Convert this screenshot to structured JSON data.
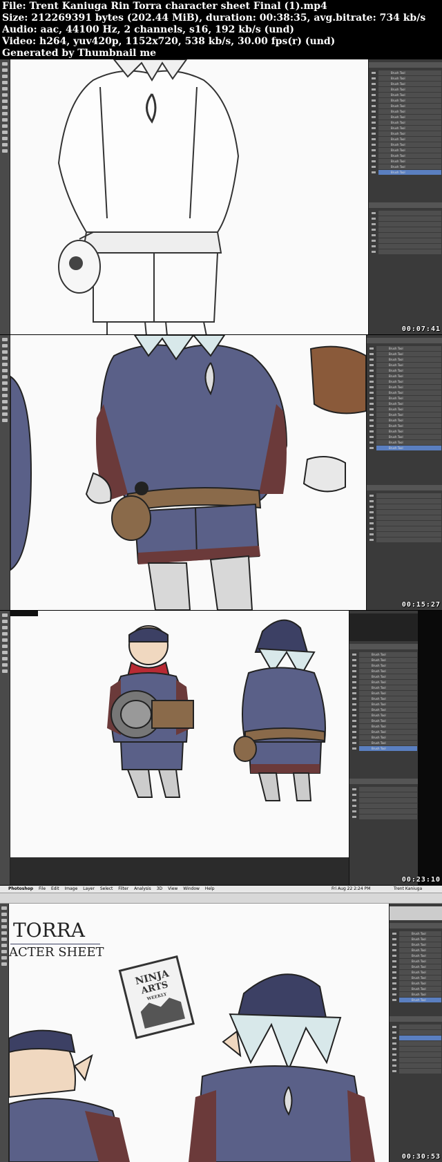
{
  "header": {
    "file_line": "File: Trent Kaniuga Rin Torra character sheet Final (1).mp4",
    "size_line": "Size: 212269391 bytes (202.44 MiB), duration: 00:38:35, avg.bitrate: 734 kb/s",
    "audio_line": "Audio: aac, 44100 Hz, 2 channels, s16, 192 kb/s (und)",
    "video_line": "Video: h264, yuv420p, 1152x720, 538 kb/s, 30.00 fps(r) (und)",
    "generated_line": "Generated by Thumbnail me"
  },
  "frames": [
    {
      "timestamp": "00:07:41"
    },
    {
      "timestamp": "00:15:27"
    },
    {
      "timestamp": "00:23:10"
    },
    {
      "timestamp": "00:30:53"
    }
  ],
  "layer_label": "Brush Tool",
  "frame4": {
    "app_name": "Photoshop",
    "menu": [
      "File",
      "Edit",
      "Image",
      "Layer",
      "Select",
      "Filter",
      "Analysis",
      "3D",
      "View",
      "Window",
      "Help"
    ],
    "clock": "Fri Aug 22 2:24 PM",
    "user": "Trent Kaniuga",
    "title_line1": "TORRA",
    "title_line2": "ACTER SHEET",
    "mag_line1": "NINJA",
    "mag_line2": "ARTS",
    "mag_line3": "WEEKLY"
  },
  "colors": {
    "robe": "#5a6088",
    "robe_dark": "#3c4064",
    "belt": "#8a6a4a",
    "scarf": "#b82a34",
    "panel_bg": "#3a3a3a",
    "selected_layer": "#5a7fc0"
  }
}
